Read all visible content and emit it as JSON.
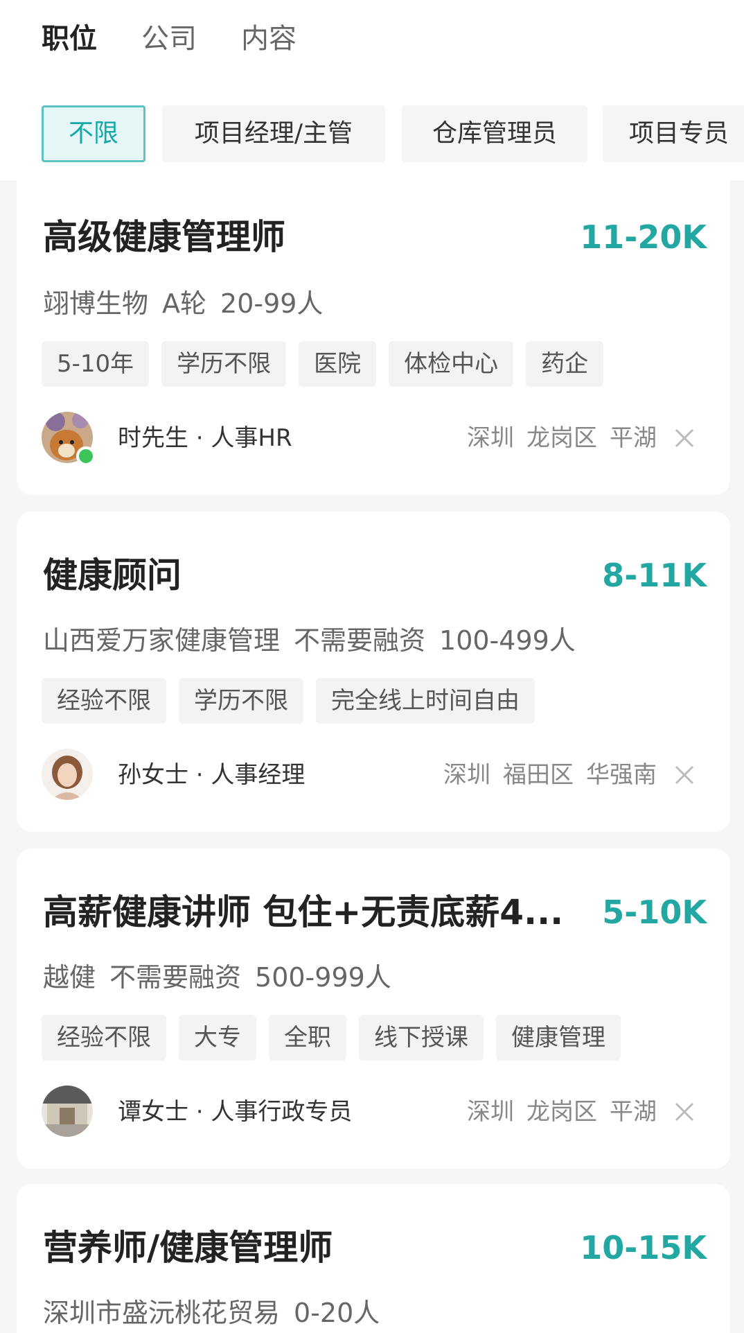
{
  "tabs": [
    {
      "label": "职位"
    },
    {
      "label": "公司"
    },
    {
      "label": "内容"
    }
  ],
  "filters": [
    {
      "label": "不限"
    },
    {
      "label": "项目经理/主管"
    },
    {
      "label": "仓库管理员"
    },
    {
      "label": "项目专员"
    }
  ],
  "jobs": [
    {
      "title": "高级健康管理师",
      "salary": "11-20K",
      "company": [
        "翊博生物",
        "A轮",
        "20-99人"
      ],
      "tags": [
        "5-10年",
        "学历不限",
        "医院",
        "体检中心",
        "药企"
      ],
      "recruiter": "时先生 · 人事HR",
      "location": [
        "深圳",
        "龙岗区",
        "平湖"
      ]
    },
    {
      "title": "健康顾问",
      "salary": "8-11K",
      "company": [
        "山西爱万家健康管理",
        "不需要融资",
        "100-499人"
      ],
      "tags": [
        "经验不限",
        "学历不限",
        "完全线上时间自由"
      ],
      "recruiter": "孙女士 · 人事经理",
      "location": [
        "深圳",
        "福田区",
        "华强南"
      ]
    },
    {
      "title": "高薪健康讲师 包住+无责底薪4...",
      "salary": "5-10K",
      "company": [
        "越健",
        "不需要融资",
        "500-999人"
      ],
      "tags": [
        "经验不限",
        "大专",
        "全职",
        "线下授课",
        "健康管理"
      ],
      "recruiter": "谭女士 · 人事行政专员",
      "location": [
        "深圳",
        "龙岗区",
        "平湖"
      ]
    },
    {
      "title": "营养师/健康管理师",
      "salary": "10-15K",
      "company": [
        "深圳市盛沅桃花贸易",
        "0-20人"
      ]
    }
  ]
}
